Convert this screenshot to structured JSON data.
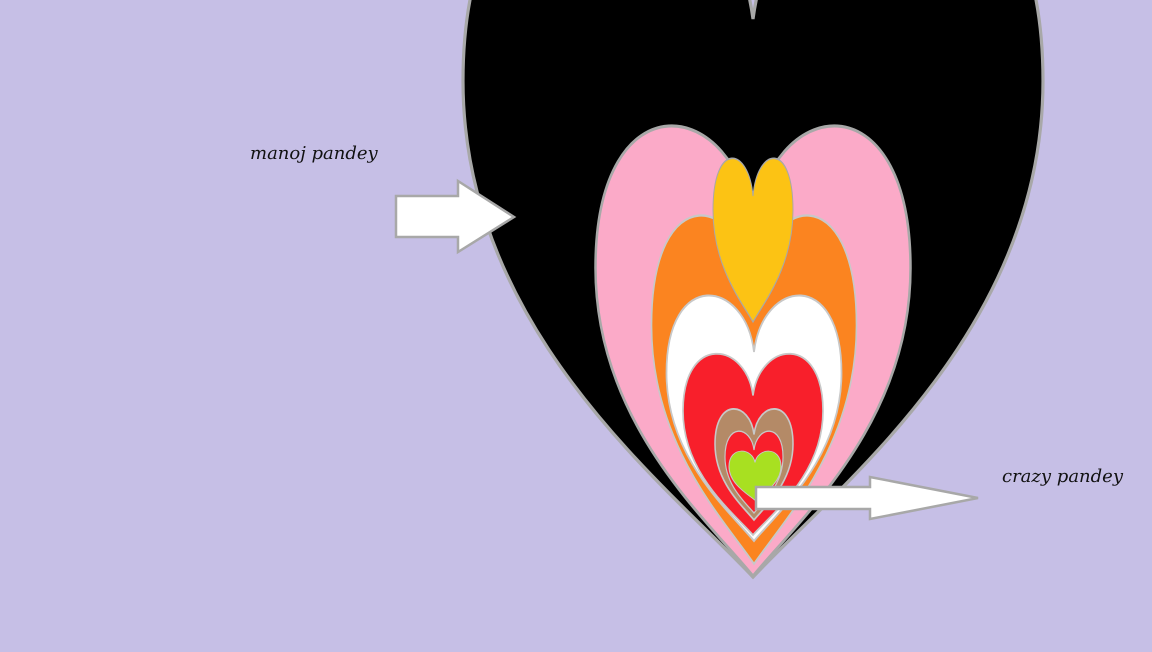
{
  "labels": {
    "left": "manoj pandey",
    "right": "crazy pandey"
  },
  "colors": {
    "background": "#c6bfe6",
    "outline": "#a8a8a8",
    "black_heart": "#000000",
    "yellow_heart": "#fcc314",
    "pink_heart": "#fbaac8",
    "orange_heart": "#fb8420",
    "white_heart": "#ffffff",
    "red_heart": "#f81f2b",
    "brown_heart": "#b48a67",
    "green_heart": "#a8e021",
    "arrow_fill": "#ffffff"
  }
}
